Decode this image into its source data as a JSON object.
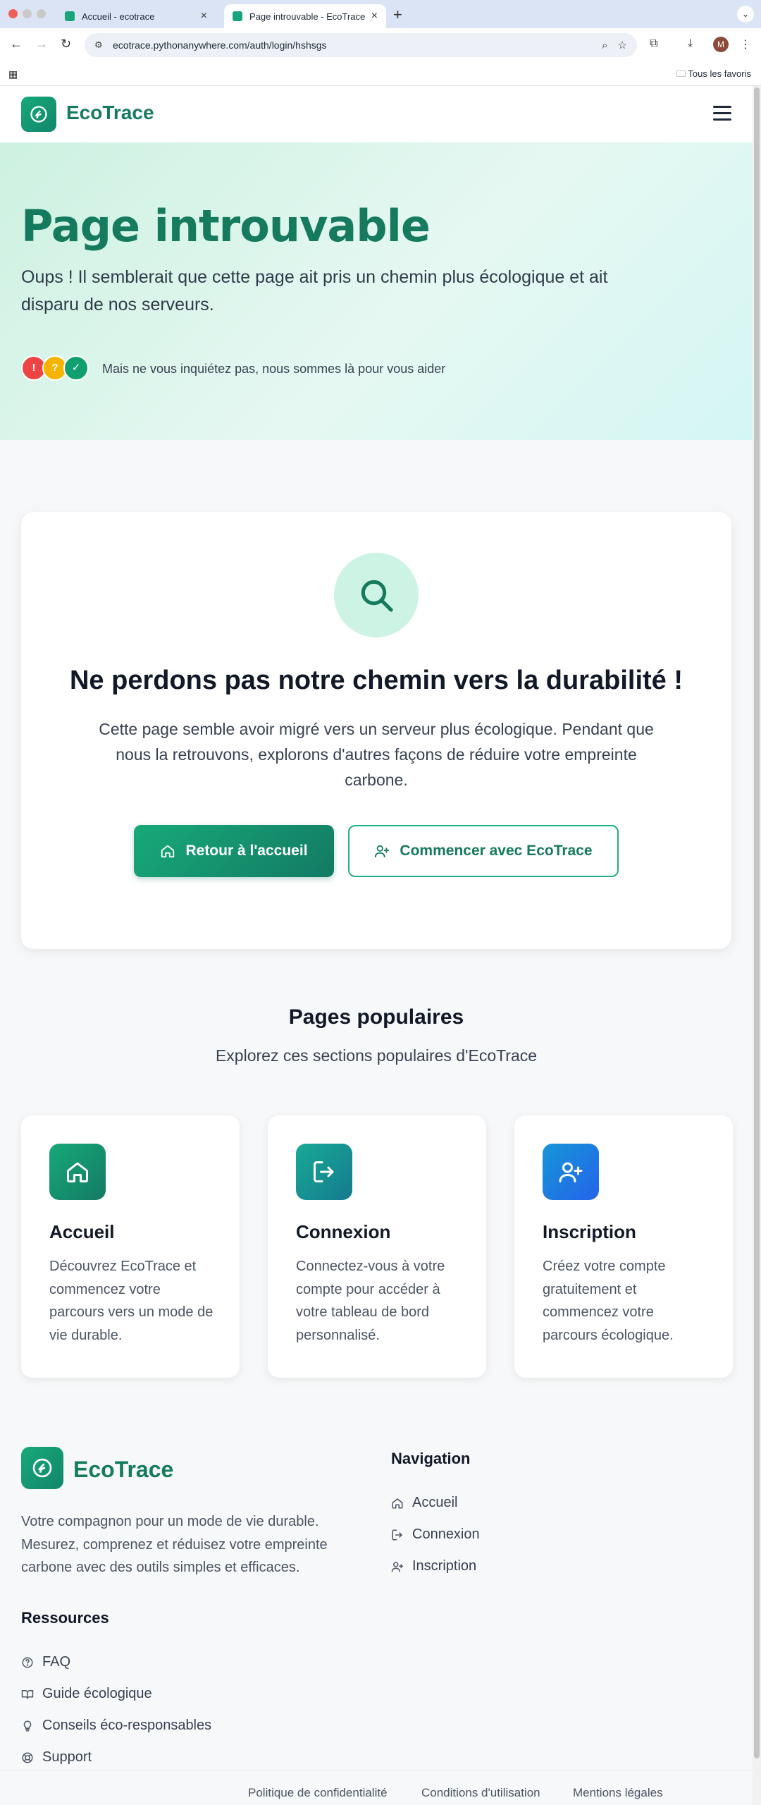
{
  "browser": {
    "tabs": [
      {
        "label": "Accueil - ecotrace",
        "active": false
      },
      {
        "label": "Page introuvable - EcoTrace",
        "active": true
      }
    ],
    "url": "ecotrace.pythonanywhere.com/auth/login/hshsgs",
    "profile_initial": "M",
    "bookmarks_label": "Tous les favoris"
  },
  "header": {
    "brand": "EcoTrace"
  },
  "hero": {
    "title": "Page introuvable",
    "subtitle": "Oups ! Il semblerait que cette page ait pris un chemin plus écologique et ait disparu de nos serveurs.",
    "badges": [
      "!",
      "?",
      "✓"
    ],
    "note": "Mais ne vous inquiétez pas, nous sommes là pour vous aider"
  },
  "main_card": {
    "title": "Ne perdons pas notre chemin vers la durabilité !",
    "text": "Cette page semble avoir migré vers un serveur plus écologique. Pendant que nous la retrouvons, explorons d'autres façons de réduire votre empreinte carbone.",
    "primary_button": "Retour à l'accueil",
    "secondary_button": "Commencer avec EcoTrace"
  },
  "popular": {
    "title": "Pages populaires",
    "subtitle": "Explorez ces sections populaires d'EcoTrace",
    "cards": [
      {
        "title": "Accueil",
        "text": "Découvrez EcoTrace et commencez votre parcours vers un mode de vie durable.",
        "icon": "home-icon"
      },
      {
        "title": "Connexion",
        "text": "Connectez-vous à votre compte pour accéder à votre tableau de bord personnalisé.",
        "icon": "login-icon"
      },
      {
        "title": "Inscription",
        "text": "Créez votre compte gratuitement et commencez votre parcours écologique.",
        "icon": "user-plus-icon"
      }
    ]
  },
  "footer": {
    "brand": "EcoTrace",
    "description": "Votre compagnon pour un mode de vie durable. Mesurez, comprenez et réduisez votre empreinte carbone avec des outils simples et efficaces.",
    "nav_title": "Navigation",
    "nav_links": [
      "Accueil",
      "Connexion",
      "Inscription"
    ],
    "resources_title": "Ressources",
    "resources_links": [
      "FAQ",
      "Guide écologique",
      "Conseils éco-responsables",
      "Support"
    ],
    "legal_links": [
      "Politique de confidentialité",
      "Conditions d'utilisation",
      "Mentions légales"
    ]
  },
  "colors": {
    "brand_green": "#157a5e",
    "accent": "#17a979",
    "badge_red": "#ef4444",
    "badge_yellow": "#f5b400",
    "badge_green": "#10a06f",
    "inscription_blue": "#2563eb"
  }
}
